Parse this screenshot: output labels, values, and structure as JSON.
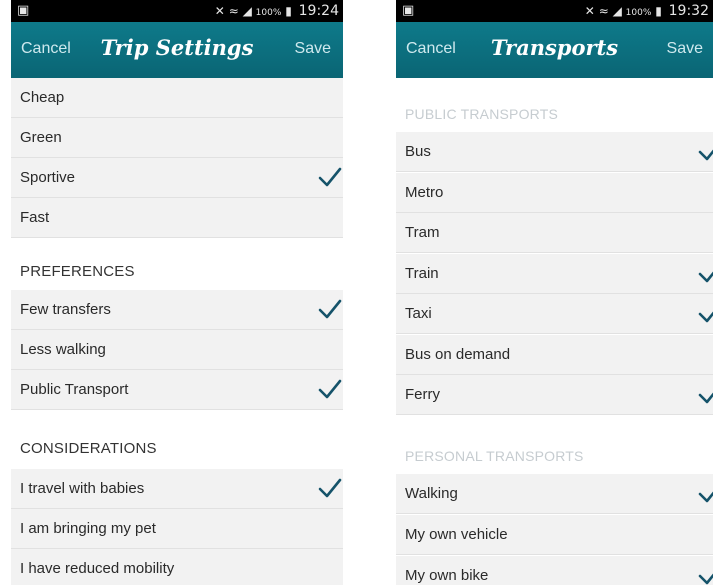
{
  "left": {
    "statusbar": {
      "time": "19:24",
      "battery": "100%"
    },
    "nav": {
      "cancel": "Cancel",
      "title": "Trip Settings",
      "save": "Save"
    },
    "mode_items": [
      {
        "label": "Cheap",
        "checked": false
      },
      {
        "label": "Green",
        "checked": false
      },
      {
        "label": "Sportive",
        "checked": true
      },
      {
        "label": "Fast",
        "checked": false
      }
    ],
    "preferences": {
      "header": "PREFERENCES",
      "items": [
        {
          "label": "Few transfers",
          "checked": true
        },
        {
          "label": "Less walking",
          "checked": false
        },
        {
          "label": "Public Transport",
          "checked": true
        }
      ]
    },
    "considerations": {
      "header": "CONSIDERATIONS",
      "items": [
        {
          "label": "I travel with babies",
          "checked": true
        },
        {
          "label": "I am bringing my pet",
          "checked": false
        },
        {
          "label": "I have reduced mobility",
          "checked": false
        }
      ]
    }
  },
  "right": {
    "statusbar": {
      "time": "19:32",
      "battery": "100%"
    },
    "nav": {
      "cancel": "Cancel",
      "title": "Transports",
      "save": "Save"
    },
    "public": {
      "header": "PUBLIC TRANSPORTS",
      "items": [
        {
          "label": "Bus",
          "checked": true
        },
        {
          "label": "Metro",
          "checked": false
        },
        {
          "label": "Tram",
          "checked": false
        },
        {
          "label": "Train",
          "checked": true
        },
        {
          "label": "Taxi",
          "checked": true
        },
        {
          "label": "Bus on demand",
          "checked": false
        },
        {
          "label": "Ferry",
          "checked": true
        }
      ]
    },
    "personal": {
      "header": "PERSONAL TRANSPORTS",
      "items": [
        {
          "label": "Walking",
          "checked": true
        },
        {
          "label": "My own vehicle",
          "checked": false
        },
        {
          "label": "My own bike",
          "checked": true
        }
      ]
    }
  },
  "colors": {
    "accent": "#0e7a8a",
    "check": "#15536a",
    "row_bg": "#f2f2f2",
    "muted_header": "#c6ccd0"
  },
  "icons": {
    "check": "checkmark-icon",
    "sim": "sim-icon",
    "wifi": "wifi-icon",
    "signal": "signal-icon",
    "battery": "battery-icon"
  }
}
